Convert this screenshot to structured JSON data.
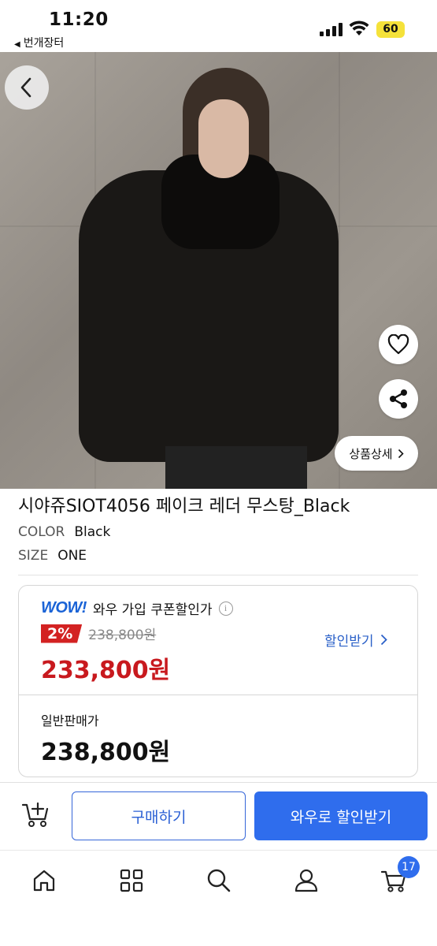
{
  "status_bar": {
    "time": "11:20",
    "back_app": "번개장터",
    "battery": "60"
  },
  "hero": {
    "image_alt": "leather shearling jacket model photo",
    "detail_button": "상품상세"
  },
  "product": {
    "title": "시야쥬SIOT4056 페이크 레더 무스탕_Black",
    "options": [
      {
        "key": "COLOR",
        "value": "Black"
      },
      {
        "key": "SIZE",
        "value": "ONE"
      }
    ]
  },
  "price_card": {
    "wow_logo": "WOW!",
    "wow_label": "와우 가입 쿠폰할인가",
    "discount_badge": "2%",
    "original_price": "238,800원",
    "sale_price": "233,800원",
    "coupon_link": "할인받기",
    "normal_label": "일반판매가",
    "normal_price": "238,800원"
  },
  "action_bar": {
    "buy_label": "구매하기",
    "wow_buy_label": "와우로 할인받기"
  },
  "bottom_nav": {
    "items": [
      "home-icon",
      "categories-icon",
      "search-icon",
      "user-icon",
      "cart-icon"
    ],
    "cart_count": "17"
  },
  "colors": {
    "accent_blue": "#2f6ded",
    "sale_red": "#c8191e",
    "battery_yellow": "#f5e23a"
  }
}
